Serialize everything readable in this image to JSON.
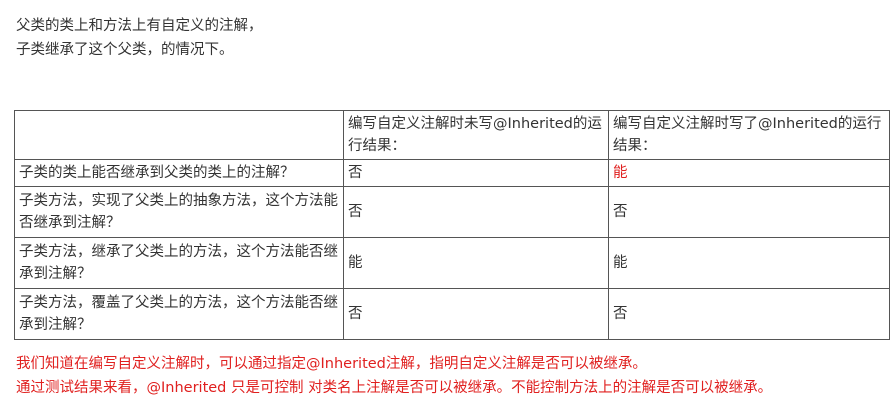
{
  "intro": {
    "line1": "父类的类上和方法上有自定义的注解，",
    "line2": "子类继承了这个父类，的情况下。"
  },
  "table": {
    "headers": [
      "",
      "编写自定义注解时未写@Inherited的运行结果：",
      "编写自定义注解时写了@Inherited的运行结果："
    ],
    "rows": [
      {
        "question": "子类的类上能否继承到父类的类上的注解？",
        "without": "否",
        "with": "能"
      },
      {
        "question": "子类方法，实现了父类上的抽象方法，这个方法能否继承到注解？",
        "without": "否",
        "with": "否"
      },
      {
        "question": "子类方法，继承了父类上的方法，这个方法能否继承到注解？",
        "without": "能",
        "with": "能"
      },
      {
        "question": "子类方法，覆盖了父类上的方法，这个方法能否继承到注解？",
        "without": "否",
        "with": "否"
      }
    ],
    "highlight_color": "#e0201f"
  },
  "notes": {
    "line1": "我们知道在编写自定义注解时，可以通过指定@Inherited注解，指明自定义注解是否可以被继承。",
    "line2": "通过测试结果来看，@Inherited 只是可控制 对类名上注解是否可以被继承。不能控制方法上的注解是否可以被继承。"
  }
}
